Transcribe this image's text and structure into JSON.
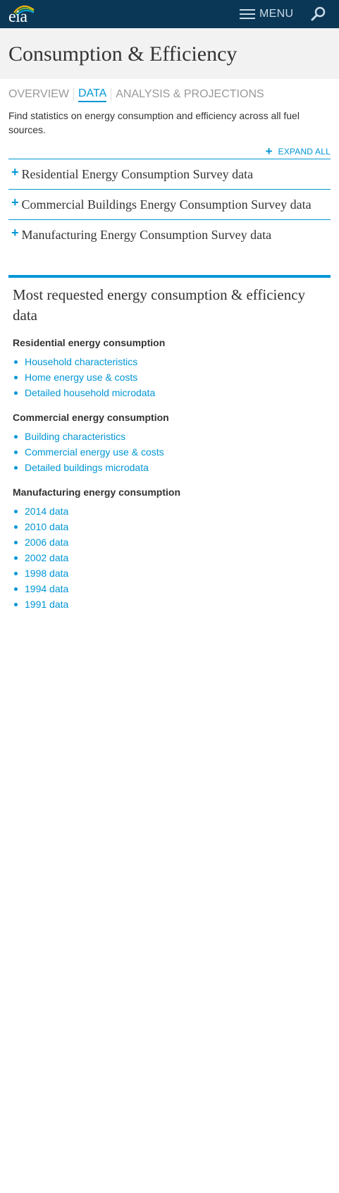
{
  "header": {
    "logo_text": "eia",
    "menu_label": "MENU",
    "colors": {
      "bar": "#0b3756",
      "accent": "#0096d6"
    }
  },
  "page": {
    "title": "Consumption & Efficiency",
    "tabs": [
      {
        "label": "OVERVIEW",
        "active": false
      },
      {
        "label": "DATA",
        "active": true
      },
      {
        "label": "ANALYSIS & PROJECTIONS",
        "active": false
      }
    ],
    "intro": "Find statistics on energy consumption and efficiency across all fuel sources.",
    "expand_all": "EXPAND ALL"
  },
  "accordion": [
    {
      "label": "Residential Energy Consumption Survey data"
    },
    {
      "label": "Commercial Buildings Energy Consumption Survey data"
    },
    {
      "label": "Manufacturing Energy Consumption Survey data"
    }
  ],
  "most_requested": {
    "title": "Most requested energy consumption & efficiency data",
    "groups": [
      {
        "heading": "Residential energy consumption",
        "links": [
          "Household characteristics",
          "Home energy use & costs",
          "Detailed household microdata"
        ]
      },
      {
        "heading": "Commercial energy consumption",
        "links": [
          "Building characteristics",
          "Commercial energy use & costs",
          "Detailed buildings microdata"
        ]
      },
      {
        "heading": "Manufacturing energy consumption",
        "links": [
          "2014 data",
          "2010 data",
          "2006 data",
          "2002 data",
          "1998 data",
          "1994 data",
          "1991 data"
        ]
      }
    ]
  }
}
